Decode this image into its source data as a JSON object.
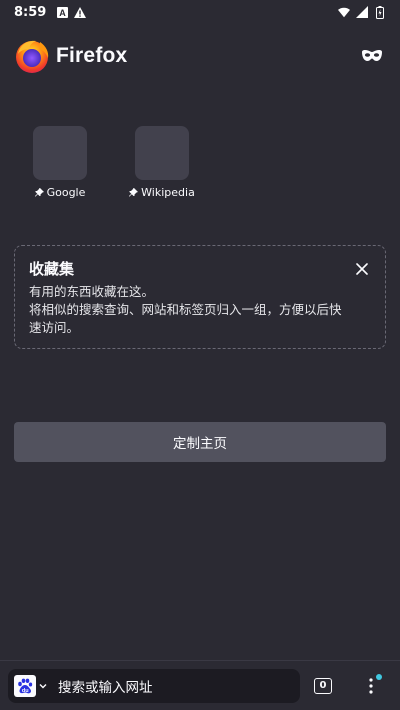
{
  "status_bar": {
    "time": "8:59",
    "icons": [
      "a-notification-icon",
      "warning-icon",
      "wifi-icon",
      "signal-icon",
      "battery-icon"
    ]
  },
  "header": {
    "app_name": "Firefox",
    "logo_icon": "firefox-logo-icon",
    "private_icon": "private-browsing-mask-icon"
  },
  "top_sites": [
    {
      "label": "Google",
      "pinned": true
    },
    {
      "label": "Wikipedia",
      "pinned": true
    }
  ],
  "collections": {
    "title": "收藏集",
    "body": "有用的东西收藏在这。\n将相似的搜索查询、网站和标签页归入一组，方便以后快速访问。"
  },
  "customize_button": {
    "label": "定制主页"
  },
  "toolbar": {
    "search_engine_icon": "baidu-icon",
    "url_placeholder": "搜索或输入网址",
    "tab_count": "0",
    "menu_icon": "more-vertical-icon"
  },
  "colors": {
    "background": "#2b2a33",
    "tile": "#42414d",
    "button": "#52525e",
    "url_bar": "#1c1b22",
    "badge": "#40c8e0"
  }
}
